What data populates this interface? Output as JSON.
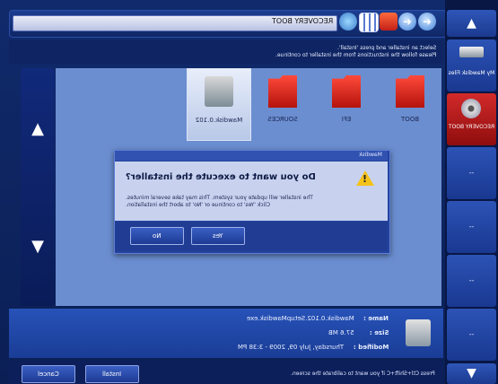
{
  "toolbar": {
    "path": "RECOVERY BOOT",
    "icons": [
      "refresh-icon",
      "grid-view-icon",
      "close-icon",
      "forward-icon",
      "back-icon"
    ]
  },
  "instructions": {
    "line1": "Select an installer and press 'Install'.",
    "line2": "Please follow the instructions from the installer to continue."
  },
  "files": [
    {
      "name": "BOOT",
      "type": "folder"
    },
    {
      "name": "EFI",
      "type": "folder"
    },
    {
      "name": "SOURCES",
      "type": "folder"
    },
    {
      "name": "Mawdisk.0.102",
      "type": "installer",
      "selected": true
    }
  ],
  "dialog": {
    "title": "Mawdisk",
    "heading": "Do you want to execute the installer?",
    "message1": "The installer will update your system. This may take several minutes.",
    "message2": "Click 'Yes' to continue or 'No' to abort the installation.",
    "yes_label": "Yes",
    "no_label": "No"
  },
  "details": {
    "name_key": "Name :",
    "name_value": "Mawdisk.0.102.SetupMawdisk.exe",
    "size_key": "Size :",
    "size_value": "57.6 MB",
    "modified_key": "Modified :",
    "modified_value": "Thursday, July 09, 2009 - 3:38 PM"
  },
  "bottom": {
    "hint": "Press Ctl+Shift+C if you want to calibrate the screen.",
    "install_label": "Install",
    "cancel_label": "Cancel"
  },
  "sidebar": {
    "items": [
      {
        "label": "My Mawdisk Files"
      },
      {
        "label": "RECOVERY BOOT",
        "active": true
      },
      {
        "label": "--"
      },
      {
        "label": "--"
      },
      {
        "label": "--"
      },
      {
        "label": "--"
      }
    ]
  }
}
